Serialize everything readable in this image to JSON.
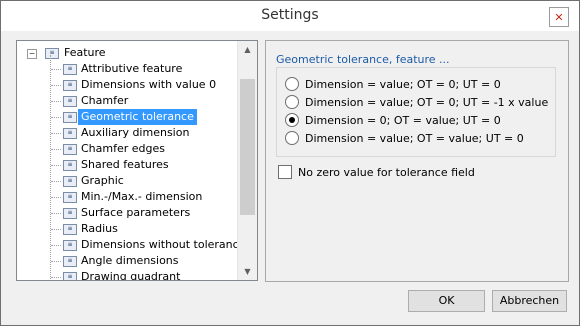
{
  "window": {
    "title": "Settings"
  },
  "tree": {
    "root": {
      "label": "Feature"
    },
    "items": [
      {
        "label": "Attributive feature"
      },
      {
        "label": "Dimensions with value 0"
      },
      {
        "label": "Chamfer"
      },
      {
        "label": "Geometric tolerance",
        "selected": true
      },
      {
        "label": "Auxiliary dimension"
      },
      {
        "label": "Chamfer edges"
      },
      {
        "label": "Shared features"
      },
      {
        "label": "Graphic"
      },
      {
        "label": "Min.-/Max.- dimension"
      },
      {
        "label": "Surface parameters"
      },
      {
        "label": "Radius"
      },
      {
        "label": "Dimensions without tolerance"
      },
      {
        "label": "Angle dimensions"
      },
      {
        "label": "Drawing quadrant"
      }
    ]
  },
  "panel": {
    "group_title": "Geometric tolerance, feature ...",
    "options": [
      {
        "label": "Dimension = value; OT = 0; UT = 0",
        "checked": false
      },
      {
        "label": "Dimension = value; OT = 0; UT = -1 x value",
        "checked": false
      },
      {
        "label": "Dimension = 0; OT = value; UT = 0",
        "checked": true
      },
      {
        "label": "Dimension = value; OT = value; UT = 0",
        "checked": false
      }
    ],
    "checkbox": {
      "label": "No zero value for tolerance field",
      "checked": false
    }
  },
  "buttons": {
    "ok": "OK",
    "cancel": "Abbrechen"
  },
  "icons": {
    "close": "close-icon",
    "tree_node": "feature-node-icon",
    "expand": "collapse-icon",
    "scroll_up": "scroll-up-icon",
    "scroll_down": "scroll-down-icon"
  }
}
